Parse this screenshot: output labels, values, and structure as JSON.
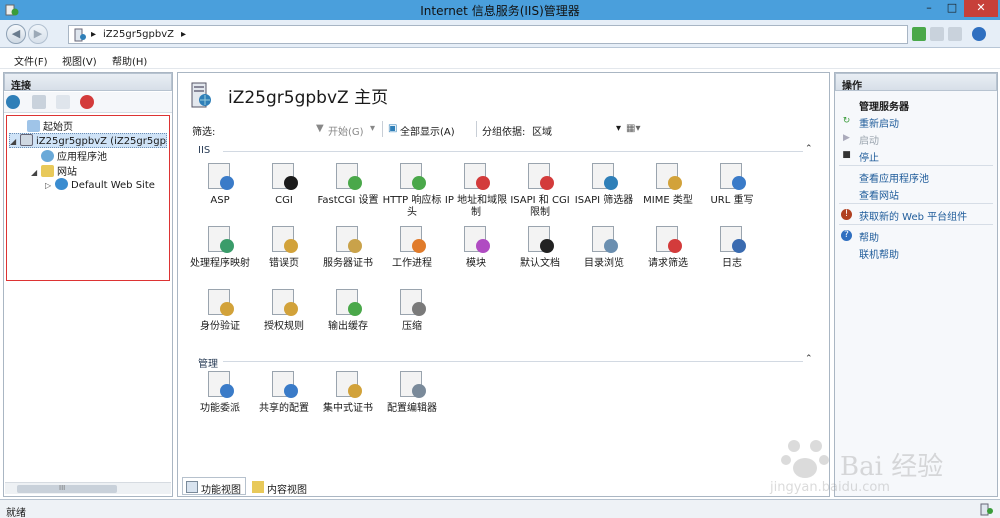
{
  "window": {
    "title": "Internet 信息服务(IIS)管理器",
    "min": "–",
    "max": "□",
    "close": "✕"
  },
  "address": {
    "path": [
      "iZ25gr5gpbvZ"
    ],
    "sep": "▸"
  },
  "menu": [
    "文件(F)",
    "视图(V)",
    "帮助(H)"
  ],
  "connections": {
    "title": "连接",
    "tree": [
      {
        "label": "起始页",
        "level": 0
      },
      {
        "label": "iZ25gr5gpbvZ (iZ25gr5gp",
        "level": 0,
        "expander": "◢"
      },
      {
        "label": "应用程序池",
        "level": 1
      },
      {
        "label": "网站",
        "level": 1,
        "expander": "◢"
      },
      {
        "label": "Default Web Site",
        "level": 2,
        "expander": "▷"
      }
    ],
    "scroll": "III"
  },
  "main": {
    "title": "iZ25gr5gpbvZ 主页",
    "filter": {
      "label": "筛选:",
      "start": "开始(G)",
      "show_all": "全部显示(A)",
      "group_by_label": "分组依据:",
      "group_by_value": "区域"
    },
    "groups": {
      "iis": "IIS",
      "manage": "管理"
    },
    "features_iis": [
      {
        "label": "ASP",
        "color": "#3a7bc8"
      },
      {
        "label": "CGI",
        "color": "#1b1b1b"
      },
      {
        "label": "FastCGI 设置",
        "color": "#4aa84a"
      },
      {
        "label": "HTTP 响应标头",
        "color": "#4aa84a"
      },
      {
        "label": "IP 地址和域限制",
        "color": "#d33b3b"
      },
      {
        "label": "ISAPI 和 CGI 限制",
        "color": "#d33b3b"
      },
      {
        "label": "ISAPI 筛选器",
        "color": "#2f7fb8"
      },
      {
        "label": "MIME 类型",
        "color": "#d2a23a"
      },
      {
        "label": "URL 重写",
        "color": "#3a7bc8"
      },
      {
        "label": "处理程序映射",
        "color": "#3a9c6a"
      },
      {
        "label": "错误页",
        "color": "#d2a23a"
      },
      {
        "label": "服务器证书",
        "color": "#c9a24a"
      },
      {
        "label": "工作进程",
        "color": "#e07b2b"
      },
      {
        "label": "模块",
        "color": "#b04cc2"
      },
      {
        "label": "默认文档",
        "color": "#222222"
      },
      {
        "label": "目录浏览",
        "color": "#6b8fb0"
      },
      {
        "label": "请求筛选",
        "color": "#d33b3b"
      },
      {
        "label": "日志",
        "color": "#3a6bb0"
      },
      {
        "label": "身份验证",
        "color": "#d2a23a"
      },
      {
        "label": "授权规则",
        "color": "#d2a23a"
      },
      {
        "label": "输出缓存",
        "color": "#4aa84a"
      },
      {
        "label": "压缩",
        "color": "#7a7a7a"
      }
    ],
    "features_manage": [
      {
        "label": "功能委派",
        "color": "#3a7bc8"
      },
      {
        "label": "共享的配置",
        "color": "#3a7bc8"
      },
      {
        "label": "集中式证书",
        "color": "#d2a23a"
      },
      {
        "label": "配置编辑器",
        "color": "#7a8a9a"
      }
    ],
    "tabs": {
      "features_view": "功能视图",
      "content_view": "内容视图"
    }
  },
  "actions": {
    "title": "操作",
    "server_group": "管理服务器",
    "items": [
      {
        "label": "重新启动",
        "icon": "restart-icon",
        "enabled": true
      },
      {
        "label": "启动",
        "icon": "start-icon",
        "enabled": false
      },
      {
        "label": "停止",
        "icon": "stop-icon",
        "enabled": true
      },
      {
        "label": "查看应用程序池",
        "icon": "",
        "enabled": true
      },
      {
        "label": "查看网站",
        "icon": "",
        "enabled": true
      },
      {
        "label": "获取新的 Web 平台组件",
        "icon": "web-platform-icon",
        "enabled": true
      },
      {
        "label": "帮助",
        "icon": "help-icon",
        "enabled": true
      },
      {
        "label": "联机帮助",
        "icon": "",
        "enabled": true
      }
    ]
  },
  "status": {
    "text": "就绪"
  },
  "watermark": {
    "brand": "Bai 经验",
    "url": "jingyan.baidu.com"
  },
  "colors": {
    "titlebar": "#4a9fdc",
    "link": "#1e5b9a",
    "close": "#c7403a"
  }
}
